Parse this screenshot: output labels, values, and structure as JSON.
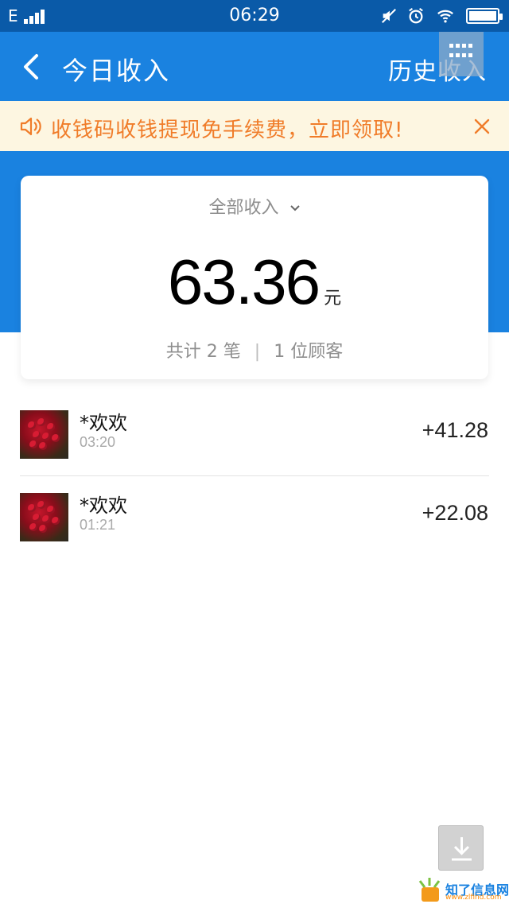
{
  "status_bar": {
    "network": "E",
    "time": "06:29"
  },
  "header": {
    "title": "今日收入",
    "history_link": "历史收入"
  },
  "notice": {
    "text": "收钱码收钱提现免手续费，立即领取!"
  },
  "summary": {
    "filter_label": "全部收入",
    "amount": "63.36",
    "unit": "元",
    "count_prefix": "共计",
    "count": "2",
    "count_suffix": "笔",
    "customers": "1",
    "customers_suffix": "位顾客"
  },
  "transactions": [
    {
      "name": "*欢欢",
      "time": "03:20",
      "amount": "+41.28"
    },
    {
      "name": "*欢欢",
      "time": "01:21",
      "amount": "+22.08"
    }
  ],
  "watermark": {
    "text": "知了信息网",
    "url": "www.zlfind.com"
  }
}
